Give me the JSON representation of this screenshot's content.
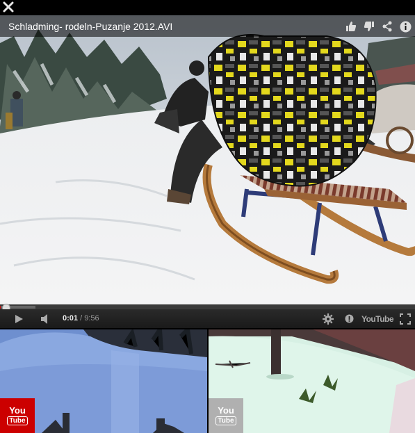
{
  "window": {
    "close_icon": "close-icon"
  },
  "video": {
    "title": "Schladming- rodeln-Puzanje 2012.AVI",
    "actions": [
      "thumbs-up-icon",
      "thumbs-down-icon",
      "share-icon",
      "info-icon"
    ]
  },
  "player": {
    "current_time": "0:01",
    "separator": " / ",
    "duration": "9:56",
    "played_fraction": 0.002,
    "loaded_fraction": 0.085,
    "youtube_label": "YouTube",
    "icons": [
      "play-icon",
      "volume-icon",
      "settings-icon",
      "annotations-icon",
      "youtube-logo",
      "fullscreen-icon"
    ]
  },
  "related": [
    {
      "badge_you": "You",
      "badge_tube": "Tube",
      "badge_color": "#cc0000"
    },
    {
      "badge_you": "You",
      "badge_tube": "Tube",
      "badge_color": "#b0b0b0"
    }
  ]
}
